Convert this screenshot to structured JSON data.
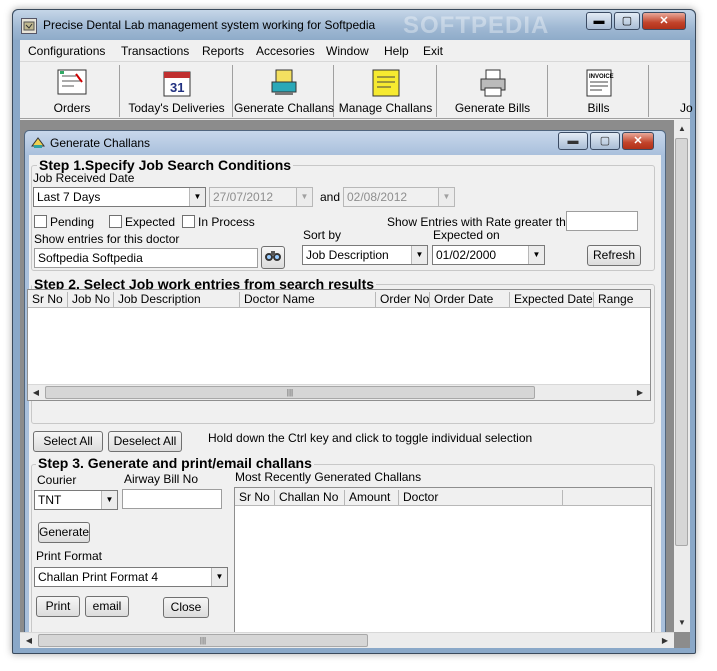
{
  "app": {
    "title": "Precise Dental Lab management system working for Softpedia",
    "watermark": "SOFTPEDIA"
  },
  "window_controls": {
    "minimize": "▬",
    "maximize": "▢",
    "close": "✕"
  },
  "menu": [
    "Configurations",
    "Transactions",
    "Reports",
    "Accesories",
    "Window",
    "Help",
    "Exit"
  ],
  "toolbar": [
    {
      "label": "Orders",
      "icon": "orders-icon"
    },
    {
      "label": "Today's Deliveries",
      "icon": "calendar-icon"
    },
    {
      "label": "Generate Challans",
      "icon": "generate-challans-icon"
    },
    {
      "label": "Manage Challans",
      "icon": "manage-challans-icon"
    },
    {
      "label": "Generate Bills",
      "icon": "printer-icon"
    },
    {
      "label": "Bills",
      "icon": "invoice-icon"
    },
    {
      "label": "Jo",
      "icon": ""
    }
  ],
  "child": {
    "title": "Generate Challans",
    "step1": {
      "title": "Step 1.Specify  Job Search Conditions",
      "job_received_label": "Job Received Date",
      "range_value": "Last 7 Days",
      "date_from": "27/07/2012",
      "and_label": "and",
      "date_to": "02/08/2012",
      "pending_label": "Pending",
      "expected_label": "Expected",
      "in_process_label": "In Process",
      "rate_label": "Show Entries with Rate greater than",
      "rate_value": "",
      "doctor_label": "Show entries for this doctor",
      "doctor_value": "Softpedia  Softpedia",
      "sortby_label": "Sort by",
      "sortby_value": "Job Description",
      "expected_on_label": "Expected on",
      "expected_on_value": "01/02/2000",
      "refresh_label": "Refresh"
    },
    "step2": {
      "title": "Step 2. Select Job work entries from search results",
      "columns": [
        "Sr No",
        "Job No",
        "Job Description",
        "Doctor Name",
        "Order No",
        "Order Date",
        "Expected Date",
        "Range"
      ],
      "select_all": "Select All",
      "deselect_all": "Deselect All",
      "hint": "Hold down the Ctrl key and click to toggle individual selection"
    },
    "step3": {
      "title": "Step 3. Generate and print/email challans",
      "courier_label": "Courier",
      "courier_value": "TNT",
      "airway_label": "Airway Bill  No",
      "airway_value": "",
      "generate_label": "Generate",
      "print_format_label": "Print Format",
      "print_format_value": "Challan Print Format 4",
      "print_label": "Print",
      "email_label": "email",
      "close_label": "Close",
      "recent_label": "Most Recently Generated Challans",
      "columns": [
        "Sr No",
        "Challan No",
        "Amount",
        "Doctor"
      ]
    }
  }
}
